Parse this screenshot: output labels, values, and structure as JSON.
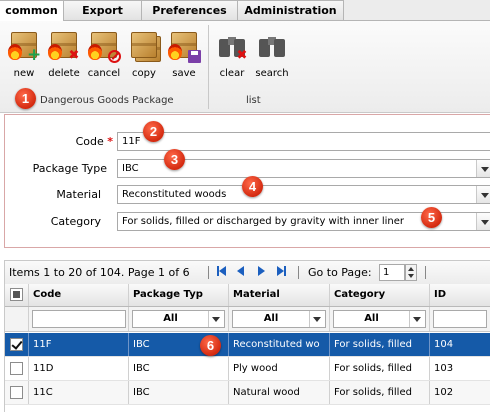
{
  "tabs": [
    "common",
    "Export",
    "Preferences",
    "Administration"
  ],
  "ribbon": {
    "buttons": [
      {
        "label": "new",
        "icon": "package-new-icon"
      },
      {
        "label": "delete",
        "icon": "package-delete-icon"
      },
      {
        "label": "cancel",
        "icon": "package-cancel-icon"
      },
      {
        "label": "copy",
        "icon": "package-copy-icon"
      },
      {
        "label": "save",
        "icon": "package-save-icon"
      },
      {
        "label": "clear",
        "icon": "binoculars-clear-icon"
      },
      {
        "label": "search",
        "icon": "binoculars-search-icon"
      }
    ],
    "group1_label": "Dangerous Goods Package",
    "group2_label": "list"
  },
  "callouts": [
    "1",
    "2",
    "3",
    "4",
    "5",
    "6"
  ],
  "form": {
    "code_label": "Code",
    "required_mark": "*",
    "code_value": "11F",
    "package_type_label": "Package Type",
    "package_type_value": "IBC",
    "material_label": "Material",
    "material_value": "Reconstituted woods",
    "category_label": "Category",
    "category_value": "For solids, filled or discharged by gravity with inner liner"
  },
  "pager": {
    "summary": "Items 1 to 20 of 104. Page 1 of 6",
    "goto_label": "Go to Page:",
    "page_value": "1"
  },
  "grid": {
    "columns": [
      "Code",
      "Package Typ",
      "Material",
      "Category",
      "ID"
    ],
    "filter_all": "All",
    "rows": [
      {
        "code": "11F",
        "package_type": "IBC",
        "material": "Reconstituted wo",
        "category": "For solids, filled",
        "id": "104",
        "selected": true
      },
      {
        "code": "11D",
        "package_type": "IBC",
        "material": "Ply wood",
        "category": "For solids, filled",
        "id": "103",
        "selected": false
      },
      {
        "code": "11C",
        "package_type": "IBC",
        "material": "Natural wood",
        "category": "For solids, filled",
        "id": "102",
        "selected": false
      }
    ]
  },
  "colors": {
    "selected_row": "#155aa8",
    "callout": "#d42a10",
    "pager_arrows": "#1b5fbf"
  }
}
